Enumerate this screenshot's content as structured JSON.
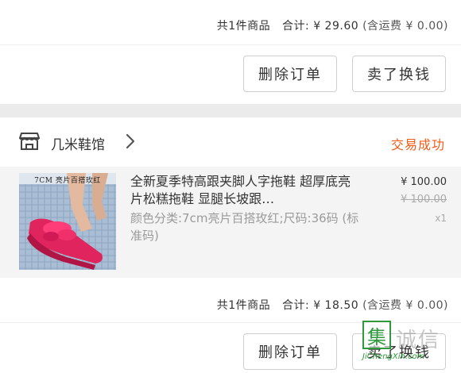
{
  "order1": {
    "summary": {
      "count_text": "共1件商品",
      "total_label": "合计:",
      "total_value": "¥ 29.60",
      "shipping_text": "(含运费 ¥ 0.00)"
    },
    "buttons": {
      "delete": "删除订单",
      "resell": "卖了换钱"
    }
  },
  "order2": {
    "shop": {
      "name": "几米鞋馆",
      "status": "交易成功"
    },
    "product": {
      "image_label": "7CM 亮片百搭玫红",
      "title": "全新夏季特高跟夹脚人字拖鞋 超厚底亮片松糕拖鞋 显腿长坡跟…",
      "variant": "颜色分类:7cm亮片百搭玫红;尺码:36码 (标准码)",
      "price": "¥ 100.00",
      "original_price": "¥ 100.00",
      "quantity": "x1"
    },
    "summary": {
      "count_text": "共1件商品",
      "total_label": "合计:",
      "total_value": "¥ 18.50",
      "shipping_text": "(含运费 ¥ 0.00)"
    },
    "buttons": {
      "delete": "删除订单",
      "resell": "卖了换钱"
    }
  },
  "watermark": {
    "glyph": "集",
    "cn": "诚信",
    "en": "JiChengXin.com"
  },
  "colors": {
    "accent": "#f25c19",
    "background": "#ebebeb",
    "card": "#ffffff",
    "product_bg": "#f4f4f4",
    "watermark_green": "#2f9a3c"
  }
}
